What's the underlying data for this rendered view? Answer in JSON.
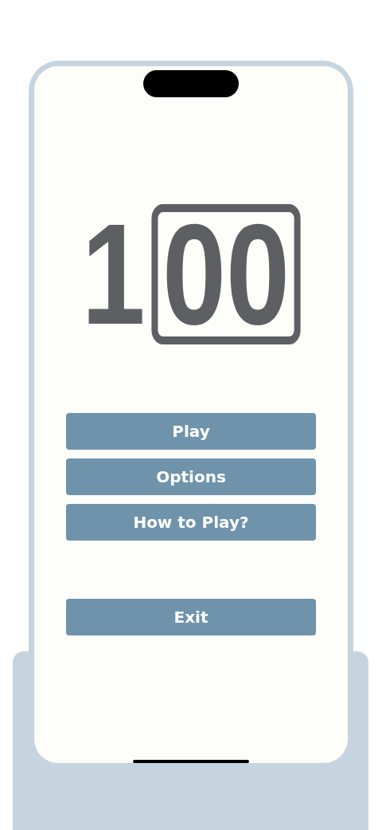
{
  "logo": {
    "lead": "1",
    "boxed": "00"
  },
  "menu": [
    {
      "label": "Play"
    },
    {
      "label": "Options"
    },
    {
      "label": "How to Play?"
    }
  ],
  "exit_button": {
    "label": "Exit"
  }
}
